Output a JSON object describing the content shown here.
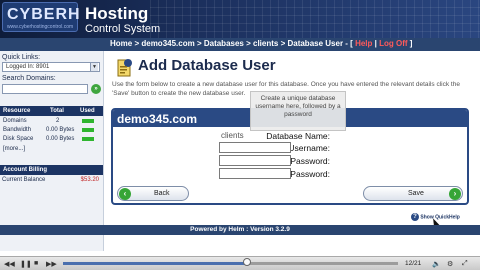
{
  "header": {
    "logo_text": "CYBERH",
    "logo_sub": "www.cyberhostingcontrol.com",
    "title_line1": "Hosting",
    "title_line2": "Control System"
  },
  "breadcrumb": {
    "home": "Home",
    "domain": "demo345.com",
    "databases": "Databases",
    "clients": "clients",
    "current": "Database User",
    "help": "Help",
    "logoff": "Log Off"
  },
  "sidebar": {
    "quick_links_label": "Quick Links:",
    "quick_links_value": "Logged In: 8901",
    "search_label": "Search Domains:",
    "go": "»",
    "resource_header": {
      "resource": "Resource",
      "total": "Total",
      "used": "Used"
    },
    "resources": [
      {
        "name": "Domains",
        "total": "2",
        "used_fraction": 0.2
      },
      {
        "name": "Bandwidth",
        "total": "0.00 Bytes",
        "used_fraction": 0.1
      },
      {
        "name": "Disk Space",
        "total": "0.00 Bytes",
        "used_fraction": 0.1
      },
      {
        "name": "[more...]",
        "total": "",
        "used_fraction": null
      }
    ],
    "account_billing": "Account Billing",
    "current_balance_label": "Current Balance",
    "current_balance_value": "$53.20"
  },
  "main": {
    "title": "Add Database User",
    "intro": "Use the form below to create a new database user for this database. Once you have entered the relevant details click the 'Save' button to create the new database user.",
    "tooltip": "Create a unique database username here, followed by a password",
    "panel_title": "demo345.com",
    "fields": {
      "db_name_label": "Database Name:",
      "db_name_value": "clients",
      "db_username_label": "Database Username:",
      "password_label": "Password:",
      "confirm_password_label": "Confirm Password:"
    },
    "back_label": "Back",
    "save_label": "Save",
    "quickhelp": "Show QuickHelp"
  },
  "footer": {
    "text": "Powered by Helm  :  Version 3.2.9"
  },
  "player": {
    "counter": "12/21",
    "progress_fraction": 0.55
  },
  "colors": {
    "header_bg": "#1b2f5c",
    "panel_border": "#2a4a84",
    "accent_green": "#36a536",
    "link_red": "#ff5a5a"
  }
}
